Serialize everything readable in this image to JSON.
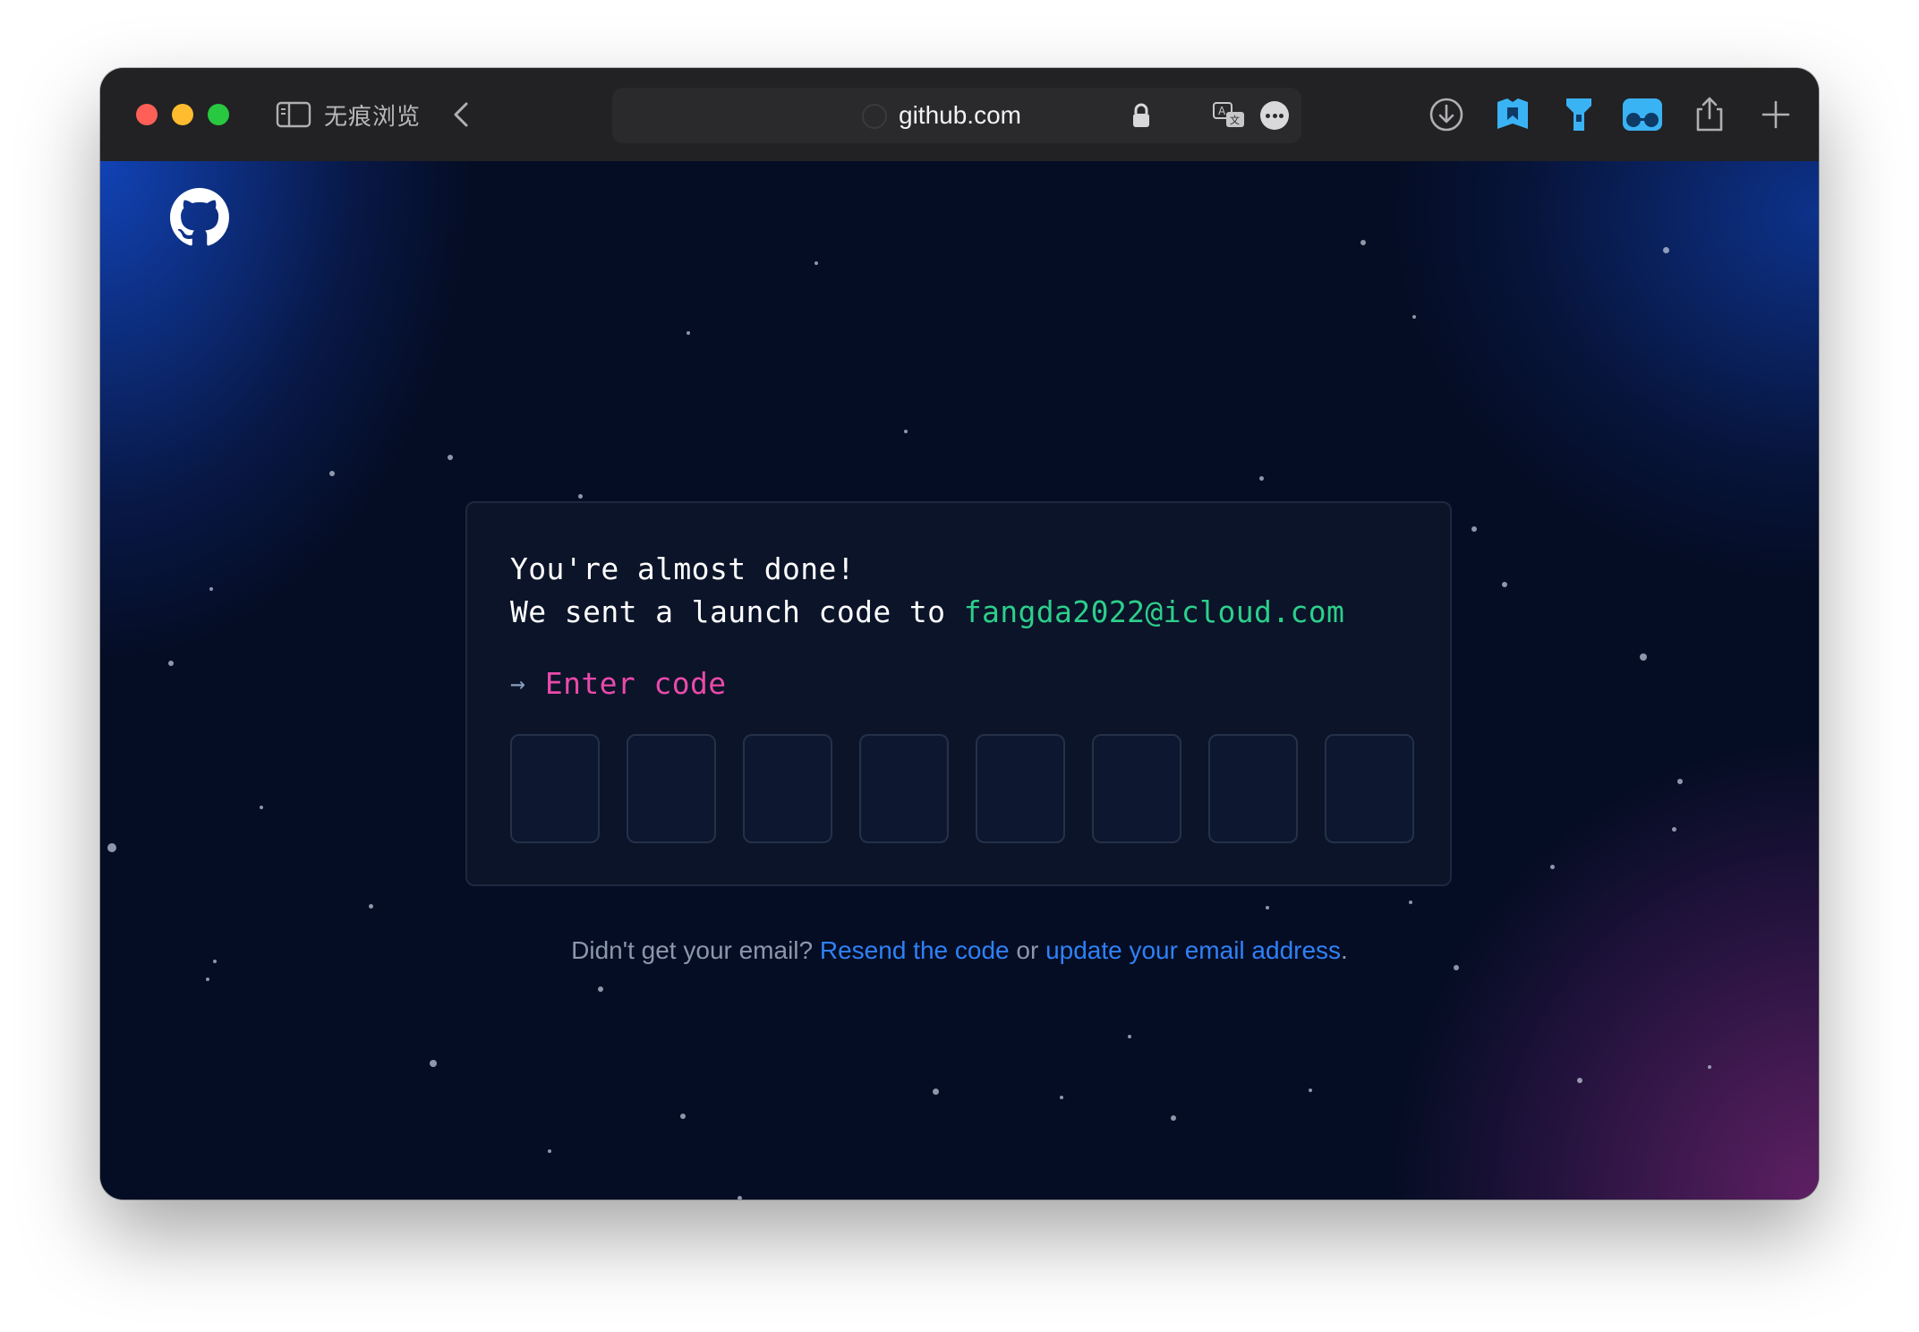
{
  "browser": {
    "tab_title": "无痕浏览",
    "url": "github.com"
  },
  "toolbar": {
    "icons": [
      "download-icon",
      "extension-bookmark-icon",
      "extension-flashlight-icon",
      "extension-glasses-icon",
      "share-icon",
      "new-tab-icon"
    ],
    "accent": "#3ab3f5"
  },
  "page": {
    "line1": "You're almost done!",
    "line2_prefix": "We sent a launch code to ",
    "email": "fangda2022@icloud.com",
    "arrow": "→",
    "prompt": "Enter code",
    "code_boxes": [
      "",
      "",
      "",
      "",
      "",
      "",
      "",
      ""
    ],
    "help_prefix": "Didn't get your email? ",
    "resend_link": "Resend the code",
    "or_text": " or ",
    "update_link": "update your email address",
    "period": "."
  },
  "colors": {
    "email": "#2ccf8b",
    "prompt": "#ea4aaa",
    "link": "#2f81f7"
  }
}
